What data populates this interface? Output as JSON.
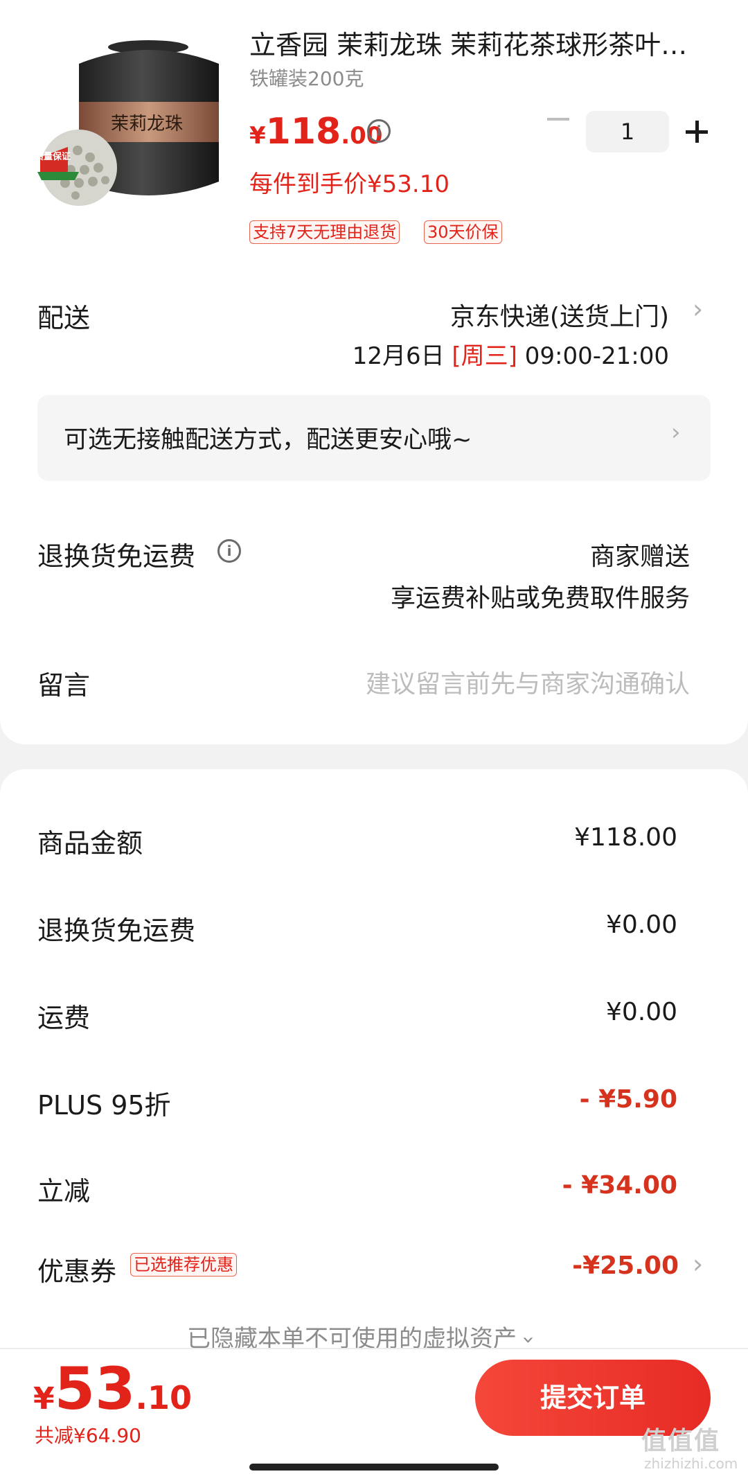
{
  "product": {
    "title": "立香园 茉莉龙珠 茉莉花茶球形茶叶…",
    "spec": "铁罐装200克",
    "jar_label": "茉莉龙珠",
    "badge": "质量保证",
    "price_currency": "¥",
    "price_int": "118",
    "price_dec": ".00",
    "unit_price": "每件到手价¥53.10",
    "tags": [
      "支持7天无理由退货",
      "30天价保"
    ],
    "quantity": "1"
  },
  "delivery": {
    "label": "配送",
    "method": "京东快递(送货上门)",
    "date": "12月6日",
    "weekday": "[周三]",
    "time": "09:00-21:00"
  },
  "notice": {
    "text": "可选无接触配送方式，配送更安心哦~"
  },
  "return_free": {
    "label": "退换货免运费",
    "value": "商家赠送",
    "sub": "享运费补贴或免费取件服务"
  },
  "message": {
    "label": "留言",
    "placeholder": "建议留言前先与商家沟通确认"
  },
  "summary": {
    "rows": [
      {
        "label": "商品金额",
        "value": "¥118.00"
      },
      {
        "label": "退换货免运费",
        "value": "¥0.00"
      },
      {
        "label": "运费",
        "value": "¥0.00"
      },
      {
        "label": "PLUS 95折",
        "value": "- ¥5.90"
      },
      {
        "label": "立减",
        "value": "- ¥34.00"
      }
    ],
    "coupon_label": "优惠券",
    "coupon_tag": "已选推荐优惠",
    "coupon_value": "-¥25.00",
    "hidden_assets": "已隐藏本单不可使用的虚拟资产"
  },
  "footer": {
    "currency": "¥",
    "total_int": "53",
    "total_dec": ".10",
    "saved": "共减¥64.90",
    "submit": "提交订单",
    "watermark": "值值值",
    "watermark_url": "zhizhizhi.com"
  },
  "colors": {
    "accent": "#e2231a",
    "button_gradient": [
      "#f5473a",
      "#e62b25"
    ],
    "page_bg": "#f2f2f2"
  }
}
